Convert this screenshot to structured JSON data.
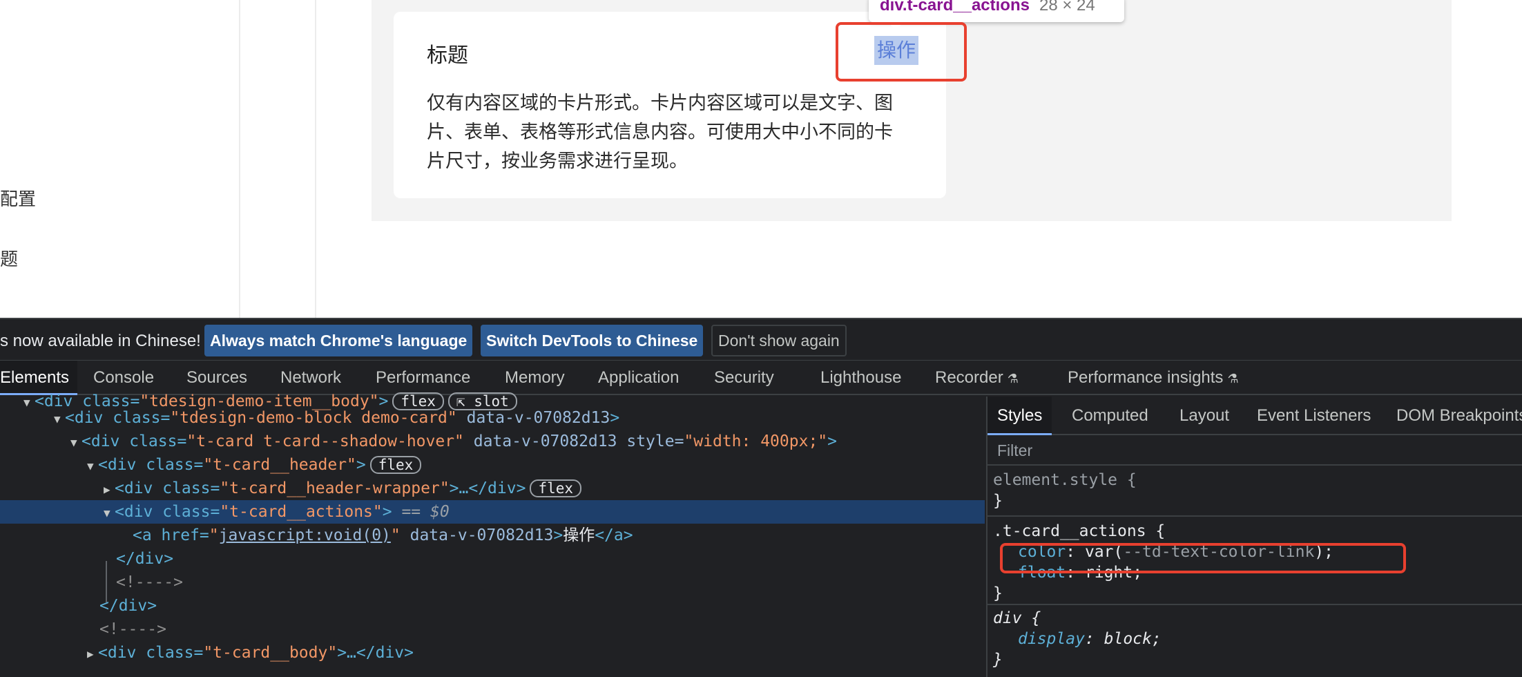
{
  "page": {
    "sidebar": {
      "item1": "配置",
      "item2": "题"
    },
    "card": {
      "title": "标题",
      "action": "操作",
      "body": "仅有内容区域的卡片形式。卡片内容区域可以是文字、图片、表单、表格等形式信息内容。可使用大中小不同的卡片尺寸，按业务需求进行呈现。"
    },
    "tooltip": {
      "selector": "div.t-card__actions",
      "size": "28 × 24"
    }
  },
  "devtools": {
    "lang_bar": {
      "message": "s now available in Chinese!",
      "btn_match": "Always match Chrome's language",
      "btn_switch": "Switch DevTools to Chinese",
      "btn_dont": "Don't show again"
    },
    "tabs": [
      "Elements",
      "Console",
      "Sources",
      "Network",
      "Performance",
      "Memory",
      "Application",
      "Security",
      "Lighthouse",
      "Recorder",
      "Performance insights"
    ],
    "elements": {
      "r0_tag": "<div class=",
      "r0_val": "\"tdesign-demo-item__body\"",
      "r0_badge1": "flex",
      "r0_badge2": "slot",
      "r1_tag": "<div class=",
      "r1_val": "\"tdesign-demo-block demo-card\"",
      "r1_attr": "data-v-07082d13",
      "r2_tag": "<div class=",
      "r2_val": "\"t-card t-card--shadow-hover\"",
      "r2_attr": "data-v-07082d13",
      "r2_style": "style=",
      "r2_style_val": "\"width: 400px;\"",
      "r3_tag": "<div class=",
      "r3_val": "\"t-card__header\"",
      "r3_badge": "flex",
      "r4_tag": "<div class=",
      "r4_val": "\"t-card__header-wrapper\"",
      "r4_end": ">…</div>",
      "r4_badge": "flex",
      "r5_tag": "<div class=",
      "r5_val": "\"t-card__actions\"",
      "r5_sel": "== $0",
      "r6_tag": "<a href=",
      "r6_link": "javascript:void(0)",
      "r6_attr": "data-v-07082d13",
      "r6_text": "操作",
      "r6_end": "</a>",
      "r7": "</div>",
      "r8": "<!---->",
      "r9": "</div>",
      "r10": "<!---->",
      "r11_tag": "<div class=",
      "r11_val": "\"t-card__body\"",
      "r11_end": ">…</div>"
    },
    "styles": {
      "tabs": [
        "Styles",
        "Computed",
        "Layout",
        "Event Listeners",
        "DOM Breakpoints"
      ],
      "filter_placeholder": "Filter",
      "rule1_selector": "element.style {",
      "rule1_close": "}",
      "rule2_selector": ".t-card__actions {",
      "rule2_p1_name": "color",
      "rule2_p1_fn": "var(",
      "rule2_p1_var": "--td-text-color-link",
      "rule2_p1_end": ");",
      "rule2_p2_name": "float",
      "rule2_p2_val": "right;",
      "rule2_close": "}",
      "rule3_selector": "div {",
      "rule3_p1_name": "display",
      "rule3_p1_val": "block;",
      "rule3_close": "}"
    }
  }
}
